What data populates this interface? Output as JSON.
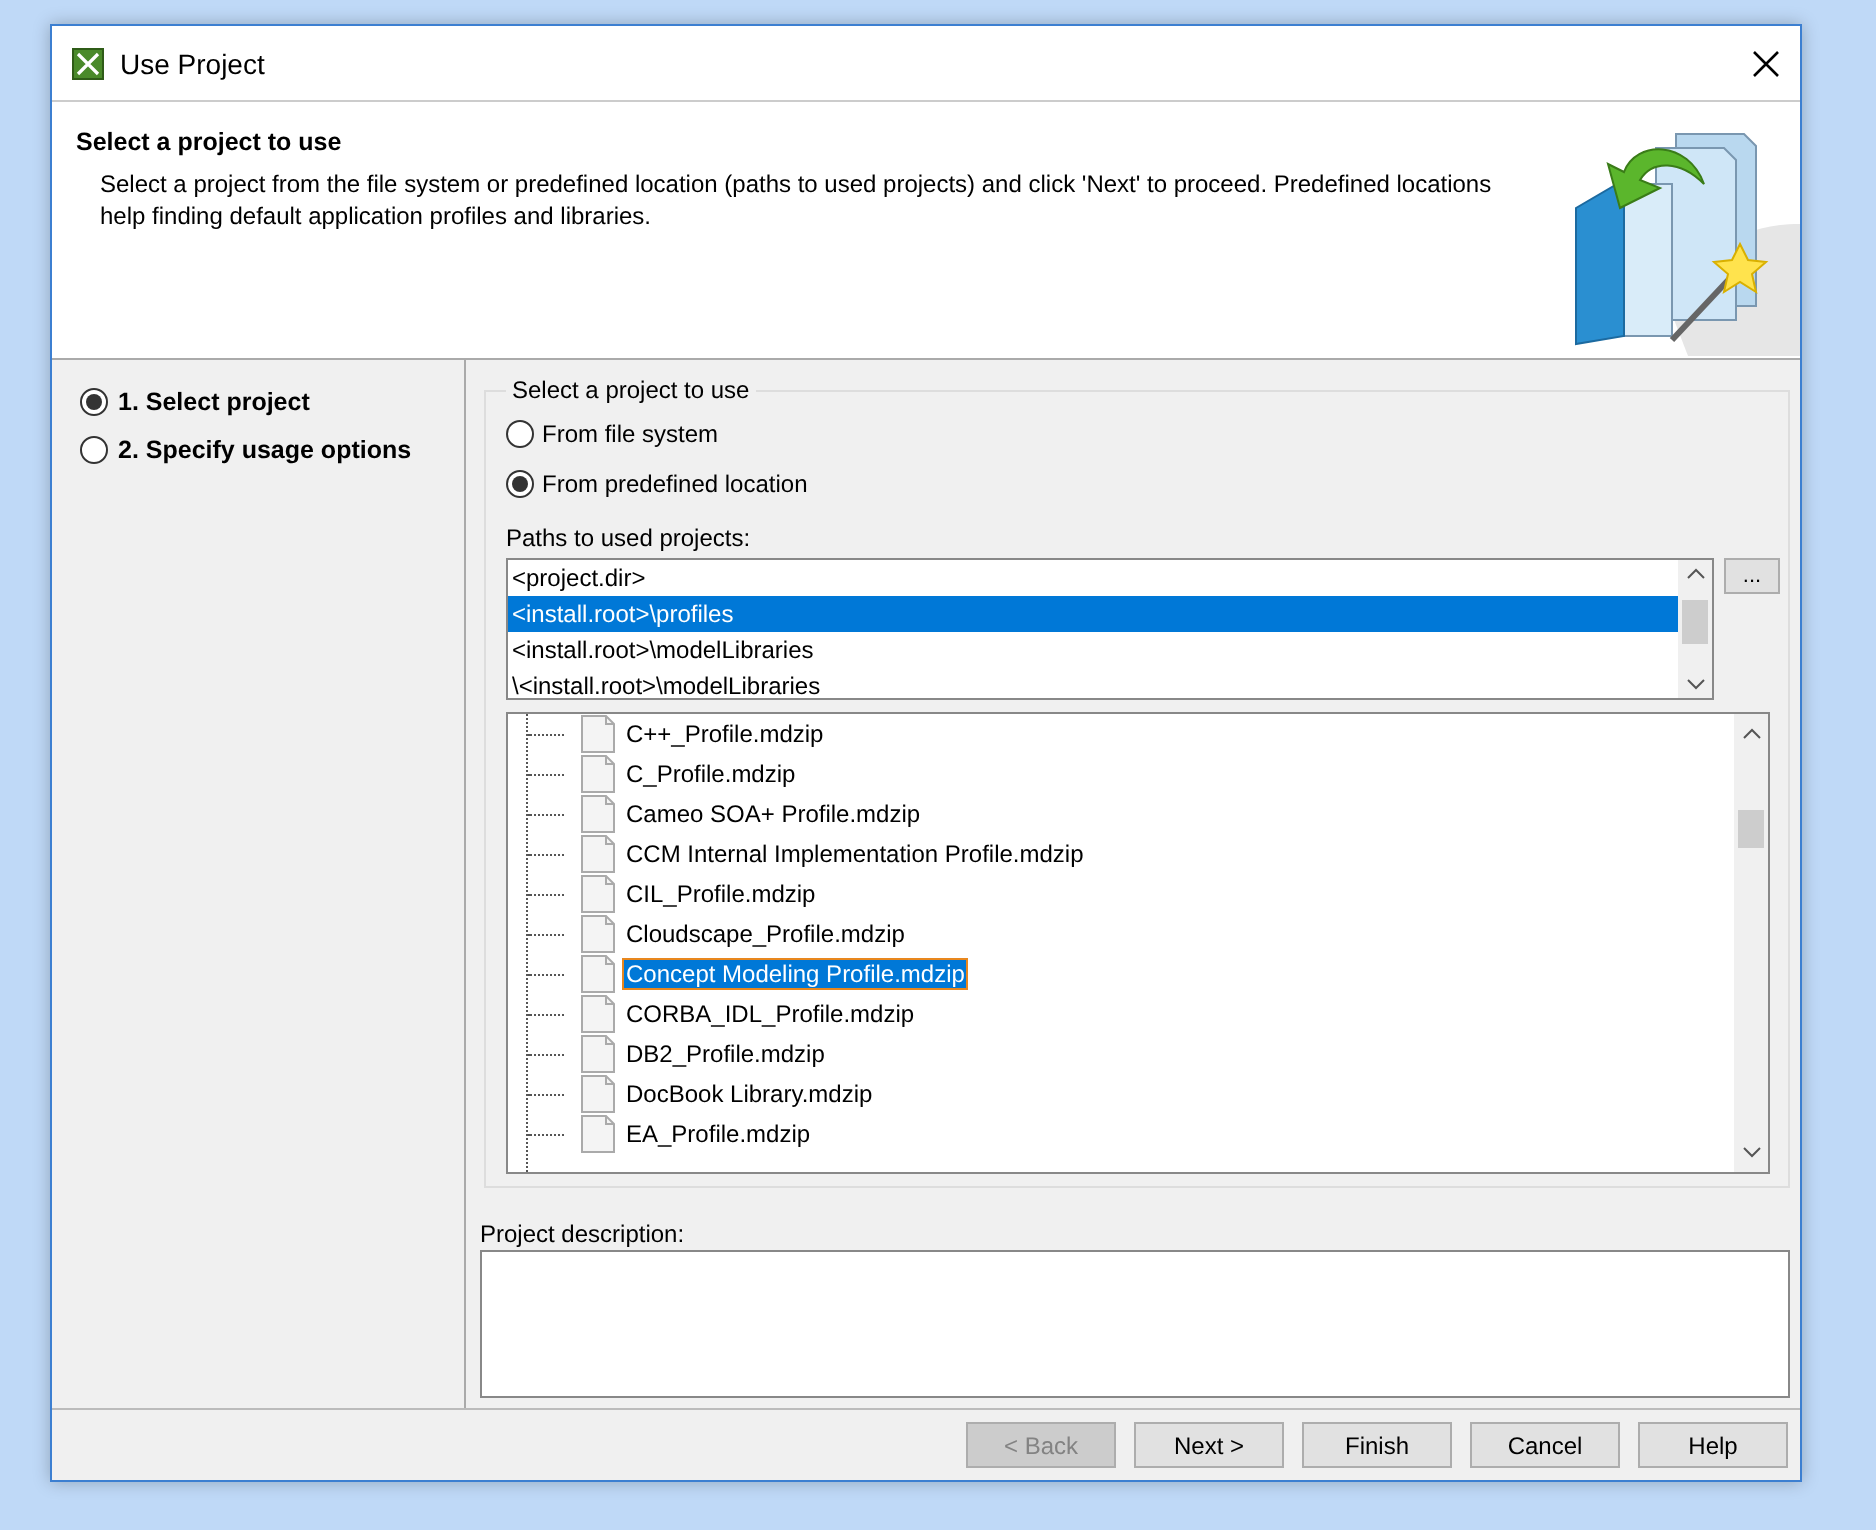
{
  "window": {
    "title": "Use Project"
  },
  "header": {
    "title": "Select a project to use",
    "description": "Select a project from the file system or predefined location (paths to used projects) and click 'Next' to proceed. Predefined locations help finding default application profiles and libraries."
  },
  "steps": [
    {
      "label": "1. Select project",
      "selected": true
    },
    {
      "label": "2. Specify usage options",
      "selected": false
    }
  ],
  "group": {
    "title": "Select a project to use"
  },
  "sources": [
    {
      "label": "From file system",
      "selected": false
    },
    {
      "label": "From predefined location",
      "selected": true
    }
  ],
  "paths": {
    "label": "Paths to used projects:",
    "browse": "...",
    "items": [
      {
        "text": "<project.dir>",
        "selected": false
      },
      {
        "text": "<install.root>\\profiles",
        "selected": true
      },
      {
        "text": "<install.root>\\modelLibraries",
        "selected": false
      },
      {
        "text": "\\<install.root>\\modelLibraries",
        "selected": false
      }
    ]
  },
  "files": [
    {
      "name": "C++_Profile.mdzip",
      "selected": false
    },
    {
      "name": "C_Profile.mdzip",
      "selected": false
    },
    {
      "name": "Cameo SOA+ Profile.mdzip",
      "selected": false
    },
    {
      "name": "CCM Internal Implementation Profile.mdzip",
      "selected": false
    },
    {
      "name": "CIL_Profile.mdzip",
      "selected": false
    },
    {
      "name": "Cloudscape_Profile.mdzip",
      "selected": false
    },
    {
      "name": "Concept Modeling Profile.mdzip",
      "selected": true
    },
    {
      "name": "CORBA_IDL_Profile.mdzip",
      "selected": false
    },
    {
      "name": "DB2_Profile.mdzip",
      "selected": false
    },
    {
      "name": "DocBook Library.mdzip",
      "selected": false
    },
    {
      "name": "EA_Profile.mdzip",
      "selected": false
    }
  ],
  "description": {
    "label": "Project description:"
  },
  "buttons": [
    {
      "label": "< Back",
      "disabled": true
    },
    {
      "label": "Next >",
      "disabled": false
    },
    {
      "label": "Finish",
      "disabled": false
    },
    {
      "label": "Cancel",
      "disabled": false
    },
    {
      "label": "Help",
      "disabled": false
    }
  ]
}
